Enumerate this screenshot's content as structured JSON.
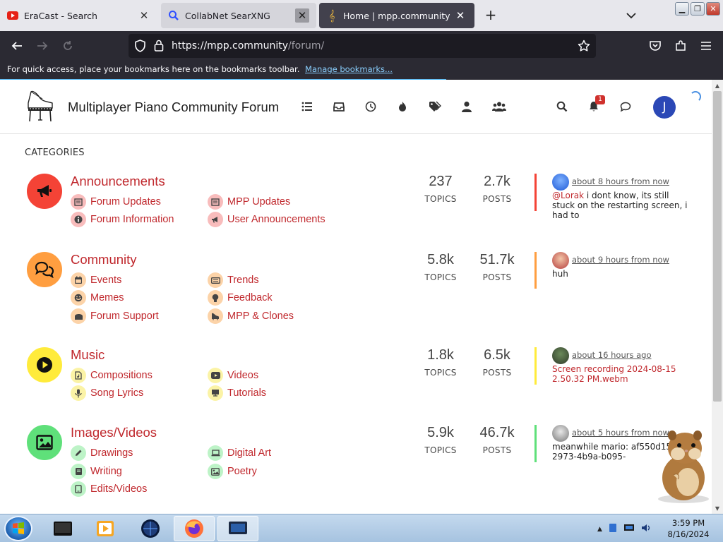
{
  "browser": {
    "tabs": [
      {
        "title": "EraCast - Search",
        "icon": "youtube-icon"
      },
      {
        "title": "CollabNet SearXNG",
        "icon": "search-icon"
      },
      {
        "title": "Home | mpp.community",
        "icon": "treble-clef-icon"
      }
    ],
    "url_host": "https://mpp.community",
    "url_path": "/forum/",
    "bookmarks_text": "For quick access, place your bookmarks here on the bookmarks toolbar.",
    "bookmarks_link": "Manage bookmarks..."
  },
  "header": {
    "title": "Multiplayer Piano Community Forum",
    "notification_count": "1",
    "user_initial": "J"
  },
  "categories_heading": "CATEGORIES",
  "categories": [
    {
      "name": "Announcements",
      "color": "#f44336",
      "sub_color": "#f8bcbc",
      "icon": "megaphone-icon",
      "subs": [
        {
          "label": "Forum Updates",
          "icon": "newspaper-icon"
        },
        {
          "label": "MPP Updates",
          "icon": "newspaper-icon"
        },
        {
          "label": "Forum Information",
          "icon": "info-icon"
        },
        {
          "label": "User Announcements",
          "icon": "megaphone-icon"
        }
      ],
      "topics": "237",
      "posts": "2.7k",
      "topics_label": "TOPICS",
      "posts_label": "POSTS",
      "recent_time": "about 8 hours from now",
      "recent_user": "@Lorak",
      "recent_text": " i dont know, its still stuck on the restarting screen, i had to"
    },
    {
      "name": "Community",
      "color": "#ff9e40",
      "sub_color": "#fcd3a8",
      "icon": "chat-bubbles-icon",
      "subs": [
        {
          "label": "Events",
          "icon": "calendar-icon"
        },
        {
          "label": "Trends",
          "icon": "keyboard-icon"
        },
        {
          "label": "Memes",
          "icon": "meme-icon"
        },
        {
          "label": "Feedback",
          "icon": "lightbulb-icon"
        },
        {
          "label": "Forum Support",
          "icon": "support-icon"
        },
        {
          "label": "MPP & Clones",
          "icon": "piano-icon"
        }
      ],
      "topics": "5.8k",
      "posts": "51.7k",
      "topics_label": "TOPICS",
      "posts_label": "POSTS",
      "recent_time": "about 9 hours from now",
      "recent_text": "huh"
    },
    {
      "name": "Music",
      "color": "#ffeb3b",
      "sub_color": "#fbf3a6",
      "icon": "play-icon",
      "subs": [
        {
          "label": "Compositions",
          "icon": "music-file-icon"
        },
        {
          "label": "Videos",
          "icon": "youtube-icon"
        },
        {
          "label": "Song Lyrics",
          "icon": "microphone-icon"
        },
        {
          "label": "Tutorials",
          "icon": "tutorial-icon"
        }
      ],
      "topics": "1.8k",
      "posts": "6.5k",
      "topics_label": "TOPICS",
      "posts_label": "POSTS",
      "recent_time": "about 16 hours ago",
      "recent_text": "Screen recording 2024-08-15 2.50.32 PM.webm"
    },
    {
      "name": "Images/Videos",
      "color": "#5fe07a",
      "sub_color": "#bdf3c7",
      "icon": "image-icon",
      "subs": [
        {
          "label": "Drawings",
          "icon": "pencil-icon"
        },
        {
          "label": "Digital Art",
          "icon": "laptop-icon"
        },
        {
          "label": "Writing",
          "icon": "book-icon"
        },
        {
          "label": "Poetry",
          "icon": "image-icon"
        },
        {
          "label": "Edits/Videos",
          "icon": "tablet-icon"
        }
      ],
      "topics": "5.9k",
      "posts": "46.7k",
      "topics_label": "TOPICS",
      "posts_label": "POSTS",
      "recent_time": "about 5 hours from now",
      "recent_text": "meanwhile mario: af550d15-2973-4b9a-b095-"
    }
  ],
  "taskbar": {
    "time": "3:59 PM",
    "date": "8/16/2024"
  }
}
